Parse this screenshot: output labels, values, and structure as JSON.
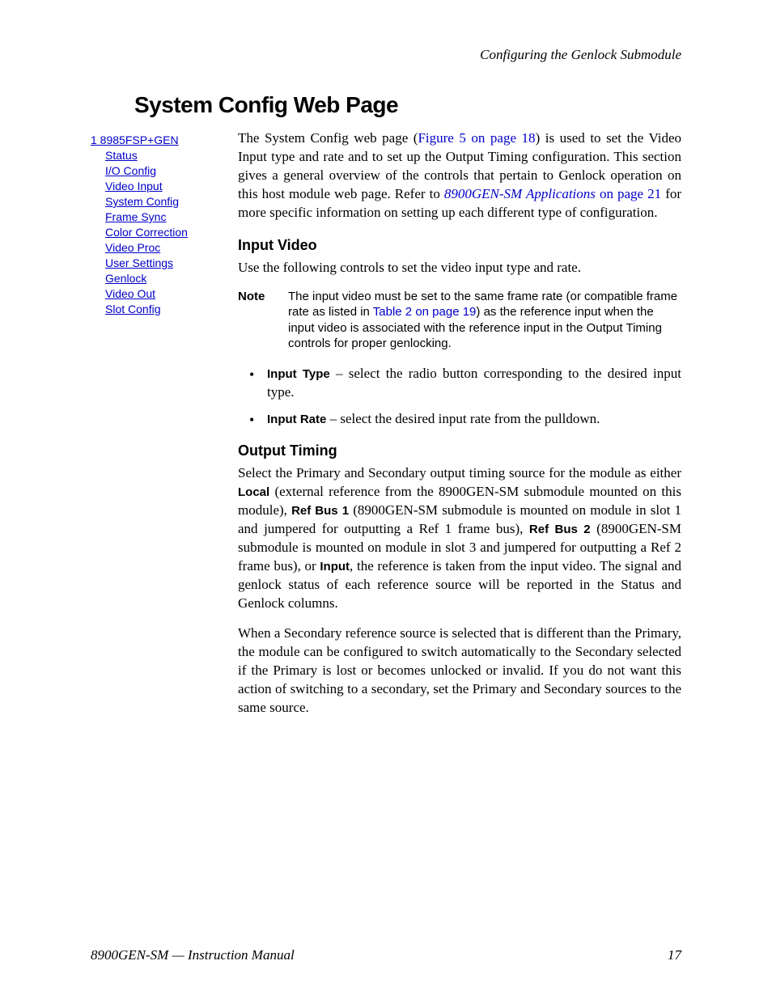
{
  "running_head": "Configuring the Genlock Submodule",
  "section_title": "System Config Web Page",
  "sidebar": {
    "root": "1 8985FSP+GEN",
    "items": [
      "Status",
      "I/O Config",
      "Video Input",
      "System Config",
      "Frame Sync",
      "Color Correction",
      "Video Proc",
      "User Settings",
      "Genlock",
      "Video Out",
      "Slot Config"
    ]
  },
  "intro": {
    "pre": "The System Config web page (",
    "link": "Figure 5 on page 18",
    "mid": ") is used to set the Video Input type and rate and to set up the Output Timing configuration. This section gives a general overview of the controls that pertain to Genlock operation on this host module web page. Refer to ",
    "link2_a": "8900GEN-SM Applications",
    "link2_b": " on page 21",
    "post": " for more specific information on setting up each different type of configuration."
  },
  "input_video": {
    "heading": "Input Video",
    "lead": "Use the following controls to set the video input type and rate.",
    "note_label": "Note",
    "note_pre": "The input video must be set to the same frame rate (or compatible frame rate as listed in ",
    "note_link": "Table 2 on page 19",
    "note_post": ") as the reference input when the input video is associated with the reference input in the Output Timing controls for proper genlocking.",
    "bullets": [
      {
        "label": "Input Type",
        "text": " – select the radio button corresponding to the desired input type."
      },
      {
        "label": "Input Rate",
        "text": " – select the desired input rate from the pulldown."
      }
    ]
  },
  "output_timing": {
    "heading": "Output Timing",
    "p1_a": "Select the Primary and Secondary output timing source for the module as either ",
    "p1_local": "Local",
    "p1_b": " (external reference from the 8900GEN-SM submodule mounted on this module), ",
    "p1_rb1": "Ref Bus 1",
    "p1_c": " (8900GEN-SM submodule is mounted on module in slot 1 and jumpered for outputting a Ref 1 frame bus), ",
    "p1_rb2": "Ref Bus 2",
    "p1_d": " (8900GEN-SM submodule is mounted on module in slot 3 and jumpered for outputting a Ref 2 frame bus), or ",
    "p1_input": "Input",
    "p1_e": ", the reference is taken from the input video. The signal and genlock status of each reference source will be reported in the Status and Genlock columns.",
    "p2": "When a Secondary reference source is selected that is different than the Primary, the module can be configured to switch automatically to the Secondary selected if the Primary is lost or becomes unlocked or invalid. If you do not want this action of switching to a secondary, set the Primary and Secondary sources to the same source."
  },
  "footer": {
    "left": "8900GEN-SM — Instruction Manual",
    "right": "17"
  }
}
